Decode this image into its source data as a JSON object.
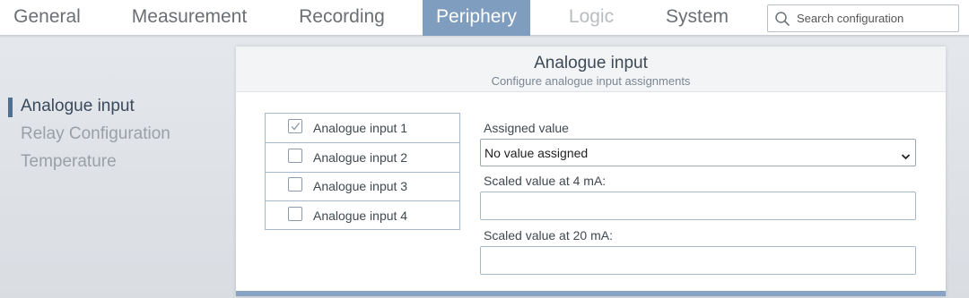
{
  "nav": {
    "tabs": [
      {
        "label": "General"
      },
      {
        "label": "Measurement"
      },
      {
        "label": "Recording"
      },
      {
        "label": "Periphery",
        "active": true
      },
      {
        "label": "Logic",
        "disabled": true
      },
      {
        "label": "System"
      }
    ],
    "search": {
      "placeholder": "Search configuration",
      "value": ""
    }
  },
  "sidebar": {
    "items": [
      {
        "label": "Analogue input",
        "active": true
      },
      {
        "label": "Relay Configuration"
      },
      {
        "label": "Temperature"
      }
    ]
  },
  "panel": {
    "title": "Analogue input",
    "subtitle": "Configure analogue input assignments",
    "inputs": [
      {
        "label": "Analogue input 1",
        "checked": true
      },
      {
        "label": "Analogue input 2",
        "checked": false
      },
      {
        "label": "Analogue input 3",
        "checked": false
      },
      {
        "label": "Analogue input 4",
        "checked": false
      }
    ],
    "assigned_value": {
      "label": "Assigned value",
      "selected": "No value assigned"
    },
    "scaled_4ma": {
      "label": "Scaled value at 4 mA:",
      "value": ""
    },
    "scaled_20ma": {
      "label": "Scaled value at 20 mA:",
      "value": ""
    }
  },
  "colors": {
    "accent": "#7f9dbf",
    "active_marker": "#4f6f93",
    "panel_bottom": "#88a3c4"
  }
}
